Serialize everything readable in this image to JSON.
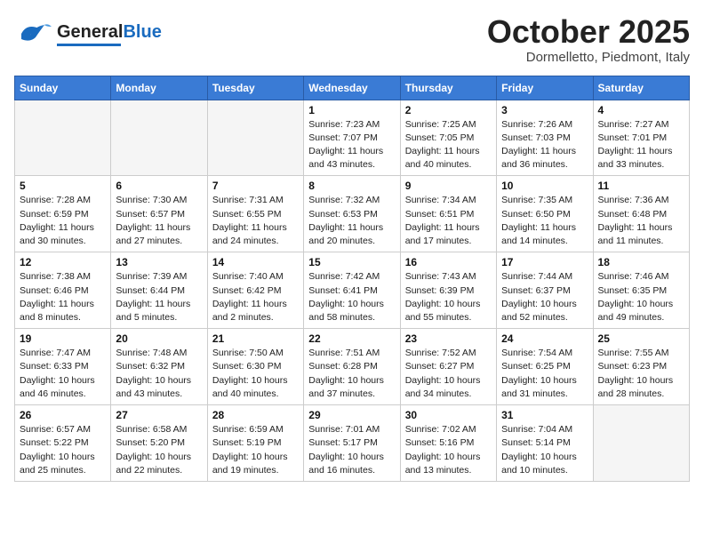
{
  "header": {
    "logo_general": "General",
    "logo_blue": "Blue",
    "month_title": "October 2025",
    "location": "Dormelletto, Piedmont, Italy"
  },
  "weekdays": [
    "Sunday",
    "Monday",
    "Tuesday",
    "Wednesday",
    "Thursday",
    "Friday",
    "Saturday"
  ],
  "weeks": [
    [
      {
        "day": "",
        "info": ""
      },
      {
        "day": "",
        "info": ""
      },
      {
        "day": "",
        "info": ""
      },
      {
        "day": "1",
        "info": "Sunrise: 7:23 AM\nSunset: 7:07 PM\nDaylight: 11 hours\nand 43 minutes."
      },
      {
        "day": "2",
        "info": "Sunrise: 7:25 AM\nSunset: 7:05 PM\nDaylight: 11 hours\nand 40 minutes."
      },
      {
        "day": "3",
        "info": "Sunrise: 7:26 AM\nSunset: 7:03 PM\nDaylight: 11 hours\nand 36 minutes."
      },
      {
        "day": "4",
        "info": "Sunrise: 7:27 AM\nSunset: 7:01 PM\nDaylight: 11 hours\nand 33 minutes."
      }
    ],
    [
      {
        "day": "5",
        "info": "Sunrise: 7:28 AM\nSunset: 6:59 PM\nDaylight: 11 hours\nand 30 minutes."
      },
      {
        "day": "6",
        "info": "Sunrise: 7:30 AM\nSunset: 6:57 PM\nDaylight: 11 hours\nand 27 minutes."
      },
      {
        "day": "7",
        "info": "Sunrise: 7:31 AM\nSunset: 6:55 PM\nDaylight: 11 hours\nand 24 minutes."
      },
      {
        "day": "8",
        "info": "Sunrise: 7:32 AM\nSunset: 6:53 PM\nDaylight: 11 hours\nand 20 minutes."
      },
      {
        "day": "9",
        "info": "Sunrise: 7:34 AM\nSunset: 6:51 PM\nDaylight: 11 hours\nand 17 minutes."
      },
      {
        "day": "10",
        "info": "Sunrise: 7:35 AM\nSunset: 6:50 PM\nDaylight: 11 hours\nand 14 minutes."
      },
      {
        "day": "11",
        "info": "Sunrise: 7:36 AM\nSunset: 6:48 PM\nDaylight: 11 hours\nand 11 minutes."
      }
    ],
    [
      {
        "day": "12",
        "info": "Sunrise: 7:38 AM\nSunset: 6:46 PM\nDaylight: 11 hours\nand 8 minutes."
      },
      {
        "day": "13",
        "info": "Sunrise: 7:39 AM\nSunset: 6:44 PM\nDaylight: 11 hours\nand 5 minutes."
      },
      {
        "day": "14",
        "info": "Sunrise: 7:40 AM\nSunset: 6:42 PM\nDaylight: 11 hours\nand 2 minutes."
      },
      {
        "day": "15",
        "info": "Sunrise: 7:42 AM\nSunset: 6:41 PM\nDaylight: 10 hours\nand 58 minutes."
      },
      {
        "day": "16",
        "info": "Sunrise: 7:43 AM\nSunset: 6:39 PM\nDaylight: 10 hours\nand 55 minutes."
      },
      {
        "day": "17",
        "info": "Sunrise: 7:44 AM\nSunset: 6:37 PM\nDaylight: 10 hours\nand 52 minutes."
      },
      {
        "day": "18",
        "info": "Sunrise: 7:46 AM\nSunset: 6:35 PM\nDaylight: 10 hours\nand 49 minutes."
      }
    ],
    [
      {
        "day": "19",
        "info": "Sunrise: 7:47 AM\nSunset: 6:33 PM\nDaylight: 10 hours\nand 46 minutes."
      },
      {
        "day": "20",
        "info": "Sunrise: 7:48 AM\nSunset: 6:32 PM\nDaylight: 10 hours\nand 43 minutes."
      },
      {
        "day": "21",
        "info": "Sunrise: 7:50 AM\nSunset: 6:30 PM\nDaylight: 10 hours\nand 40 minutes."
      },
      {
        "day": "22",
        "info": "Sunrise: 7:51 AM\nSunset: 6:28 PM\nDaylight: 10 hours\nand 37 minutes."
      },
      {
        "day": "23",
        "info": "Sunrise: 7:52 AM\nSunset: 6:27 PM\nDaylight: 10 hours\nand 34 minutes."
      },
      {
        "day": "24",
        "info": "Sunrise: 7:54 AM\nSunset: 6:25 PM\nDaylight: 10 hours\nand 31 minutes."
      },
      {
        "day": "25",
        "info": "Sunrise: 7:55 AM\nSunset: 6:23 PM\nDaylight: 10 hours\nand 28 minutes."
      }
    ],
    [
      {
        "day": "26",
        "info": "Sunrise: 6:57 AM\nSunset: 5:22 PM\nDaylight: 10 hours\nand 25 minutes."
      },
      {
        "day": "27",
        "info": "Sunrise: 6:58 AM\nSunset: 5:20 PM\nDaylight: 10 hours\nand 22 minutes."
      },
      {
        "day": "28",
        "info": "Sunrise: 6:59 AM\nSunset: 5:19 PM\nDaylight: 10 hours\nand 19 minutes."
      },
      {
        "day": "29",
        "info": "Sunrise: 7:01 AM\nSunset: 5:17 PM\nDaylight: 10 hours\nand 16 minutes."
      },
      {
        "day": "30",
        "info": "Sunrise: 7:02 AM\nSunset: 5:16 PM\nDaylight: 10 hours\nand 13 minutes."
      },
      {
        "day": "31",
        "info": "Sunrise: 7:04 AM\nSunset: 5:14 PM\nDaylight: 10 hours\nand 10 minutes."
      },
      {
        "day": "",
        "info": ""
      }
    ]
  ]
}
